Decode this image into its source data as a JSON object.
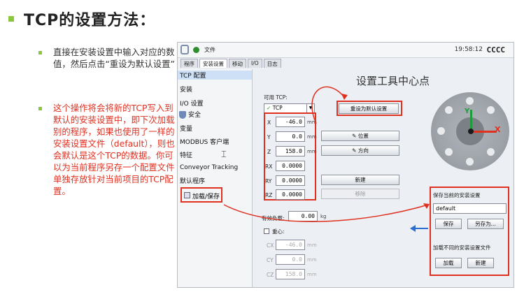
{
  "slide": {
    "title": "TCP的设置方法：",
    "bullets": [
      "直接在安装设置中输入对应的数值，然后点击“重设为默认设置”",
      "这个操作将会将新的TCP写入到默认的安装设置中，即下次加载别的程序，如果也使用了一样的安装设置文件（default），则也会默认是这个TCP的数据。你可以为当前程序另存一个配置文件单独存放针对当前项目的TCP配置。"
    ]
  },
  "app": {
    "file_label": "文件",
    "clock": "19:58:12",
    "robot_name": "CCCC",
    "tabs": [
      "程序",
      "安装设置",
      "移动",
      "I/O",
      "日志"
    ],
    "sidebar": [
      "TCP 配置",
      "安装",
      "I/O 设置",
      "安全",
      "变量",
      "MODBUS 客户端",
      "特征",
      "Conveyor Tracking",
      "默认程序",
      "加载/保存"
    ],
    "title": "设置工具中心点",
    "active_tcp_label": "可用 TCP:",
    "tcp_selected": "TCP",
    "set_default_button": "重设为默认设置",
    "fields": [
      {
        "name": "X",
        "value": "-46.0",
        "unit": "mm"
      },
      {
        "name": "Y",
        "value": "0.0",
        "unit": "mm"
      },
      {
        "name": "Z",
        "value": "158.0",
        "unit": "mm"
      },
      {
        "name": "RX",
        "value": "0.0000",
        "unit": ""
      },
      {
        "name": "RY",
        "value": "0.0000",
        "unit": ""
      },
      {
        "name": "RZ",
        "value": "0.0000",
        "unit": ""
      }
    ],
    "position_button": "位置",
    "orientation_button": "方向",
    "new_button": "新建",
    "remove_button": "移除",
    "payload_label": "有效负载:",
    "payload_value": "0.00",
    "payload_unit": "kg",
    "cog_label": "重心:",
    "cog_fields": [
      {
        "name": "CX",
        "value": "-46.0",
        "unit": "mm"
      },
      {
        "name": "CY",
        "value": "0.0",
        "unit": "mm"
      },
      {
        "name": "CZ",
        "value": "158.0",
        "unit": "mm"
      }
    ],
    "axis_y": "Y",
    "axis_x": "X",
    "save_panel": {
      "save_title": "保存当前的安装设置",
      "filename": "default",
      "save_button": "保存",
      "save_as_button": "另存为...",
      "load_title": "加载不同的安装设置文件",
      "load_button": "加载",
      "new_button": "新建"
    }
  },
  "colors": {
    "accent_green": "#8cc63f",
    "annotation_red": "#e03020",
    "arrow_blue": "#2a6fd0"
  }
}
